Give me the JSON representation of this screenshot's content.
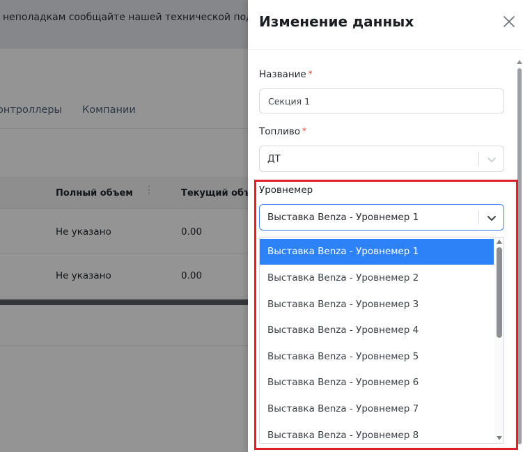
{
  "background": {
    "banner_text": "неполадкам сообщайте нашей технической поддержке",
    "tabs": [
      "онтроллеры",
      "Компании"
    ],
    "table": {
      "columns": [
        "Полный объем",
        "Текущий объем"
      ],
      "rows": [
        {
          "full_volume": "Не указано",
          "current_volume": "0.00"
        },
        {
          "full_volume": "Не указано",
          "current_volume": "0.00"
        }
      ]
    }
  },
  "drawer": {
    "title": "Изменение данных",
    "fields": {
      "name": {
        "label": "Название",
        "required_mark": "*",
        "value": "Секция 1"
      },
      "fuel": {
        "label": "Топливо",
        "required_mark": "*",
        "value": "ДТ"
      },
      "level_gauge": {
        "label": "Уровнемер",
        "value": "Выставка Benza - Уровнемер 1"
      }
    },
    "dropdown_options": [
      "Выставка Benza - Уровнемер 1",
      "Выставка Benza - Уровнемер 2",
      "Выставка Benza - Уровнемер 3",
      "Выставка Benza - Уровнемер 4",
      "Выставка Benza - Уровнемер 5",
      "Выставка Benza - Уровнемер 6",
      "Выставка Benza - Уровнемер 7",
      "Выставка Benza - Уровнемер 8"
    ],
    "selected_option_index": 0
  },
  "colors": {
    "accent": "#2e82f7",
    "required": "#e0452f",
    "highlight": "#e11f2a",
    "overlay": "rgba(0,0,0,0.42)"
  },
  "icons": {
    "close": "close-icon",
    "chevron": "chevron-down-icon"
  }
}
